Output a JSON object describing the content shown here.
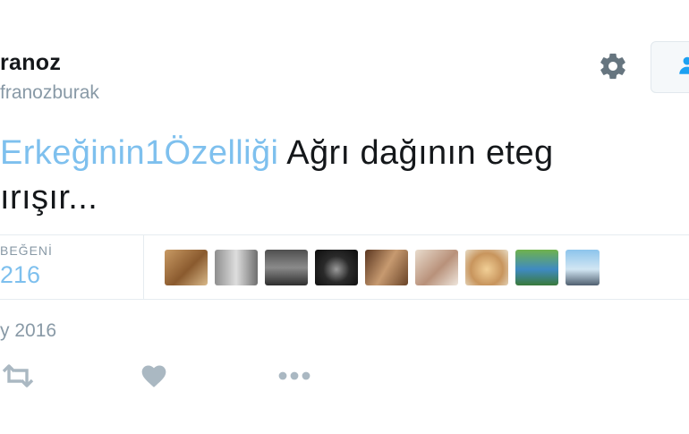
{
  "profile": {
    "display_name": "ranoz",
    "handle": "franozburak"
  },
  "tweet": {
    "hashtag": "Erkeğinin1Özelliği",
    "text_rest": " Ağrı dağının eteg",
    "text_line2": "ırışır..."
  },
  "stats": {
    "likes_label": "BEĞENİ",
    "likes_count": "216"
  },
  "meta": {
    "date": "y 2016"
  },
  "icons": {
    "gear": "gear-icon",
    "follow": "follow-user-icon",
    "retweet": "retweet-icon",
    "like": "heart-icon",
    "more": "more-dots-icon"
  },
  "colors": {
    "accent": "#7ec0ee",
    "text": "#14171a",
    "muted": "#8899a6",
    "icon": "#aab8c2",
    "follow_icon": "#1da1f2"
  }
}
